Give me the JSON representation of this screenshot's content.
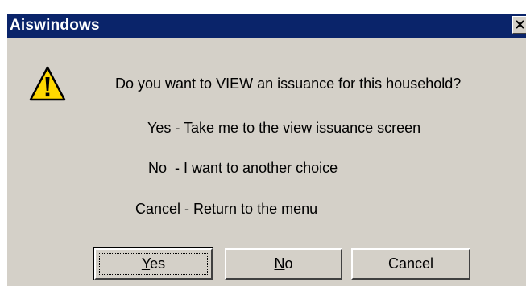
{
  "window": {
    "title": "Aiswindows",
    "close_icon": "close-icon"
  },
  "icon": {
    "name": "warning-icon",
    "color": "#ffd800"
  },
  "message": {
    "question": "Do you want to VIEW an issuance for this household?",
    "yes_explanation": "Yes - Take me to the view issuance screen",
    "no_explanation": "No  - I want to another choice",
    "cancel_explanation": "Cancel - Return to the menu"
  },
  "buttons": {
    "yes": {
      "mnemonic": "Y",
      "rest": "es"
    },
    "no": {
      "mnemonic": "N",
      "rest": "o"
    },
    "cancel": "Cancel"
  },
  "colors": {
    "titlebar": "#0a246a",
    "dialog_bg": "#d4d0c8"
  }
}
